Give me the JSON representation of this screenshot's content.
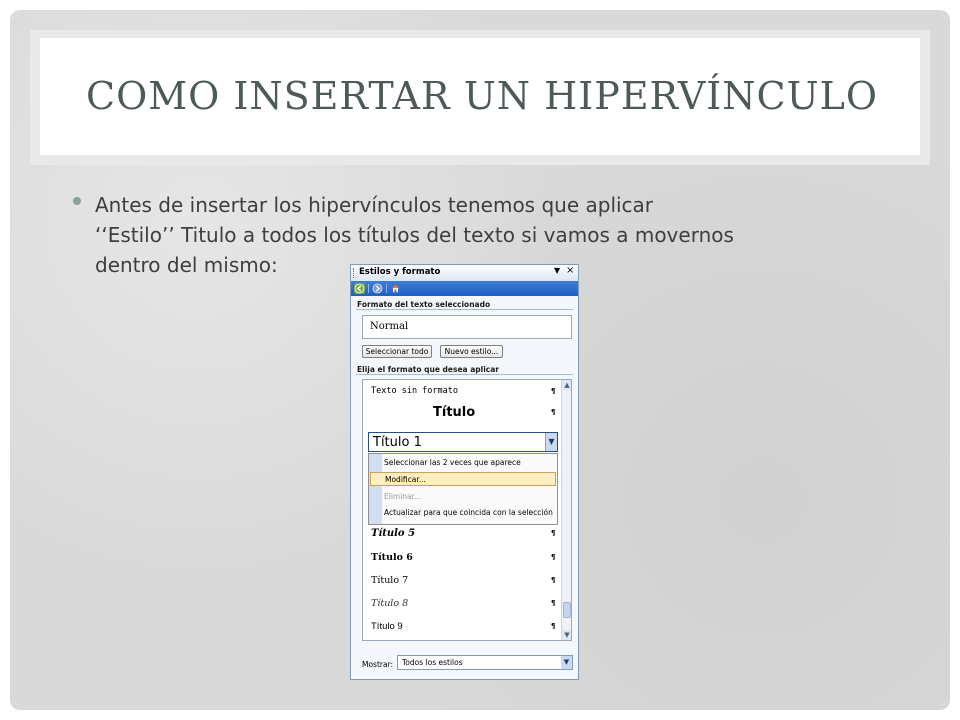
{
  "slide": {
    "title": "COMO INSERTAR UN HIPERVÍNCULO",
    "bullet_lines": [
      "Antes de insertar los hipervínculos tenemos que aplicar",
      "‘‘Estilo’’ Titulo a todos los títulos del texto si vamos a movernos",
      "dentro del mismo:"
    ],
    "accent_color": "#8aa197"
  },
  "pane": {
    "title": "Estilos y formato",
    "dropdown_glyph": "▼",
    "close_glyph": "×",
    "toolbar_icons": [
      "back-icon",
      "forward-icon",
      "home-icon"
    ],
    "section_selected_label": "Formato del texto seleccionado",
    "current_format": "Normal",
    "select_all_button": "Seleccionar todo",
    "new_style_button": "Nuevo estilo...",
    "section_apply_label": "Elija el formato que desea aplicar",
    "paragraph_mark": "¶",
    "styles_top": [
      {
        "label": "Texto sin formato"
      },
      {
        "label": "Título"
      }
    ],
    "selected_style": "Título 1",
    "context_menu": [
      {
        "label": "Seleccionar las 2 veces que aparece",
        "state": "normal"
      },
      {
        "label": "Modificar...",
        "state": "highlighted"
      },
      {
        "label": "Eliminar...",
        "state": "disabled"
      },
      {
        "label": "Actualizar para que coincida con la selección",
        "state": "normal"
      }
    ],
    "styles_bottom": [
      {
        "label": "Título 5"
      },
      {
        "label": "Título 6"
      },
      {
        "label": "Título 7"
      },
      {
        "label": "Título 8"
      },
      {
        "label": "Título 9"
      }
    ],
    "show_label": "Mostrar:",
    "show_value": "Todos los estilos"
  }
}
